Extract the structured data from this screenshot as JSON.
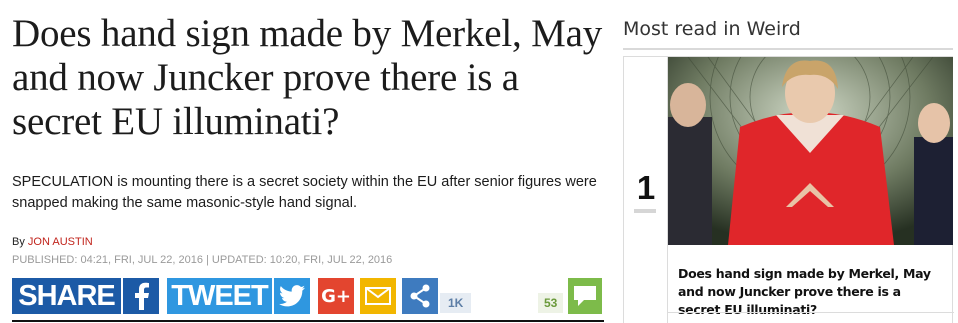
{
  "article": {
    "headline": "Does hand sign made by Merkel, May and now Juncker prove there is a secret EU illuminati?",
    "standfirst": "SPECULATION is mounting there is a secret society within the EU after senior figures were snapped making the same masonic-style hand signal.",
    "byline_prefix": "By",
    "author": "JON AUSTIN",
    "dates": "PUBLISHED: 04:21, Fri, Jul 22, 2016 | UPDATED: 10:20, Fri, Jul 22, 2016"
  },
  "share": {
    "share_label": "SHARE",
    "tweet_label": "TWEET",
    "facebook_icon": "facebook-icon",
    "twitter_icon": "twitter-bird-icon",
    "gplus_label": "G+",
    "share_count": "1K",
    "comments_count": "53",
    "colors": {
      "facebook": "#1c5aa6",
      "twitter": "#2f97e0",
      "gplus": "#e3452f",
      "email": "#f2b600",
      "share": "#3e7bbf",
      "comments": "#7dbb4a"
    }
  },
  "sidebar": {
    "title": "Most read in Weird",
    "items": [
      {
        "rank": "1",
        "title": "Does hand sign made by Merkel, May and now Juncker prove there is a secret EU illuminati?"
      }
    ]
  }
}
